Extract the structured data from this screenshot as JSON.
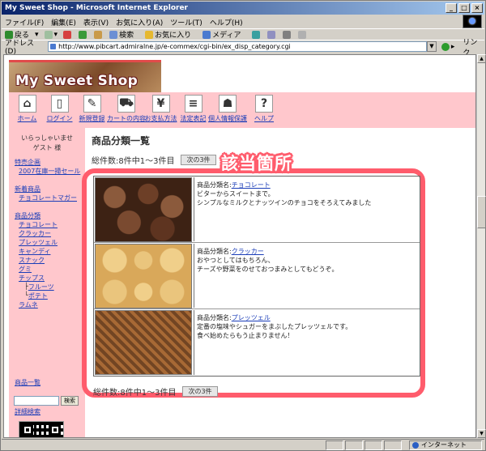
{
  "window": {
    "title": "My Sweet Shop - Microsoft Internet Explorer",
    "controls": [
      "_",
      "□",
      "×"
    ]
  },
  "menubar": {
    "items": [
      "ファイル(F)",
      "編集(E)",
      "表示(V)",
      "お気に入り(A)",
      "ツール(T)",
      "ヘルプ(H)"
    ]
  },
  "toolbar": {
    "back": "戻る",
    "search": "検索",
    "favorites": "お気に入り",
    "media": "メディア"
  },
  "address": {
    "label": "アドレス(D)",
    "url": "http://www.pibcart.admiralne.jp/e-commex/cgi-bin/ex_disp_category.cgi",
    "go_icon": "go-arrow-icon",
    "links_label": "リンク"
  },
  "status": {
    "zone": "インターネット"
  },
  "site": {
    "banner_title": "My Sweet Shop",
    "nav": [
      {
        "label": "ホーム",
        "icon": "home-icon",
        "glyph": "⌂"
      },
      {
        "label": "ログイン",
        "icon": "login-door-icon",
        "glyph": "▯"
      },
      {
        "label": "新規登録",
        "icon": "signup-pen-icon",
        "glyph": "✎"
      },
      {
        "label": "カートの内容",
        "icon": "cart-icon",
        "glyph": "⛟"
      },
      {
        "label": "お支払方法",
        "icon": "yen-icon",
        "glyph": "¥"
      },
      {
        "label": "法定表記",
        "icon": "document-icon",
        "glyph": "≡"
      },
      {
        "label": "個人情報保護",
        "icon": "person-icon",
        "glyph": "☗"
      },
      {
        "label": "ヘルプ",
        "icon": "help-icon",
        "glyph": "?"
      }
    ]
  },
  "sidebar": {
    "welcome_line1": "いらっしゃいませ",
    "welcome_line2": "ゲスト 様",
    "special_heading": "特売企画",
    "special_item": "2007在庫一掃セール",
    "new_heading": "新着商品",
    "new_item": "チョコレートマガー",
    "category_heading": "商品分類",
    "categories": [
      "チョコレート",
      "クラッカー",
      "プレッツェル",
      "キャンディ",
      "スナック",
      "グミ",
      "チップス"
    ],
    "chips_children": [
      "フルーツ",
      "ポテト"
    ],
    "last_category": "ラムネ",
    "product_list": "商品一覧",
    "search_button": "検索",
    "advanced_search": "詳細検索"
  },
  "main": {
    "title": "商品分類一覧",
    "count_text": "総件数:8件中1〜3件目",
    "next_button": "次の3件",
    "highlight_label": "該当箇所",
    "name_prefix": "商品分類名:",
    "products": [
      {
        "name": "チョコレート",
        "line1": "ビターからスイートまで。",
        "line2": "シンプルなミルクとナッツインのチョコをそろえてみました"
      },
      {
        "name": "クラッカー",
        "line1": "おやつとしてはもちろん、",
        "line2": "チーズや野菜をのせておつまみとしてもどうぞ。"
      },
      {
        "name": "プレッツェル",
        "line1": "定番の塩味やシュガーをまぶしたプレッツェルです。",
        "line2": "食べ始めたらもう止まりません！"
      }
    ]
  },
  "colors": {
    "page_pink": "#ffc7cc",
    "highlight": "#ff5c6c",
    "link": "#1a3db8"
  }
}
